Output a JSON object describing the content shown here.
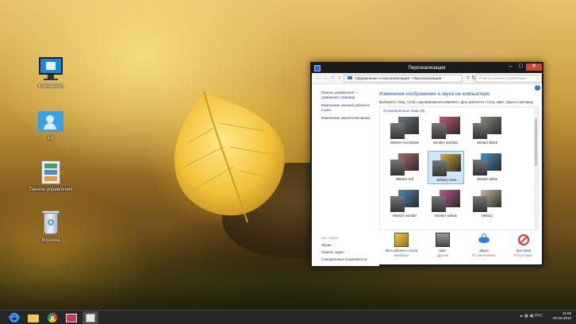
{
  "desktop": {
    "icons": [
      {
        "label": "Компьютер",
        "icon": "monitor-icon"
      },
      {
        "label": "Irit",
        "icon": "user-folder-icon"
      },
      {
        "label": "Панель управления",
        "icon": "control-panel-icon"
      },
      {
        "label": "Корзина",
        "icon": "recycle-bin-icon"
      }
    ]
  },
  "window": {
    "title": "Персонализация",
    "address": {
      "parts": [
        "Оформление и персонализация",
        "›",
        "Персонализация"
      ],
      "search_placeholder": "Поиск в панели управления"
    },
    "left_pane": {
      "links": [
        "Панель управления — домашняя страница",
        "Изменение значков рабочего стола",
        "Изменение указателей мыши"
      ],
      "see_also_heading": "См. также",
      "see_also": [
        "Экран",
        "Панель задач",
        "Специальные возможности"
      ]
    },
    "main": {
      "heading": "Изменение изображения и звука на компьютере",
      "description": "Выберите тему, чтобы одновременно изменить фон рабочего стола, цвет, звуки и заставку.",
      "themes_label": "Установленные темы (9)",
      "themes": [
        {
          "name": "Win8zz-AeroGlass",
          "accent": "#6d7a82"
        },
        {
          "name": "Win8zz-archdior",
          "accent": "#c25a6a"
        },
        {
          "name": "Win8zz-black",
          "accent": "#8a8a7a"
        },
        {
          "name": "Win8zz-red",
          "accent": "#b06a72"
        },
        {
          "name": "Win8zz-vista",
          "accent": "#d8a93a"
        },
        {
          "name": "Win8zz-white",
          "accent": "#3f95c8"
        },
        {
          "name": "Win8zz-wonder",
          "accent": "#4a8ab0"
        },
        {
          "name": "Win8zz-yellow",
          "accent": "#b85a90"
        },
        {
          "name": "Win8zz",
          "accent": "#c9b9a0"
        }
      ],
      "selected_theme": "Win8zz-vista",
      "bottom": [
        {
          "label": "Фон рабочего стола",
          "value": "Wallpaper",
          "icon": "wallpaper-icon"
        },
        {
          "label": "Цвет",
          "value": "Другой",
          "icon": "color-swatch-icon"
        },
        {
          "label": "Звуки",
          "value": "По умолчанию",
          "icon": "sounds-icon"
        },
        {
          "label": "Заставка",
          "value": "Отсутствует",
          "icon": "screensaver-icon"
        }
      ]
    }
  },
  "taskbar": {
    "apps": [
      "internet-explorer-icon",
      "file-explorer-icon",
      "chrome-icon",
      "photos-icon",
      "control-panel-icon"
    ],
    "tray_text": "РУС",
    "time": "11:06",
    "date": "02.02.2013"
  }
}
